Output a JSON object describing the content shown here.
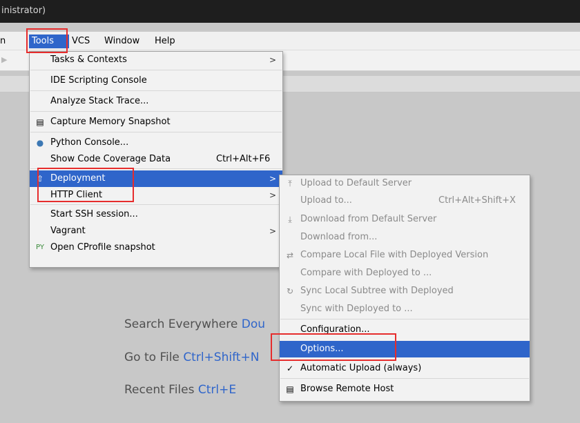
{
  "window": {
    "title": "inistrator)"
  },
  "menubar": {
    "items": [
      {
        "label": "n"
      },
      {
        "label": "Tools"
      },
      {
        "label": "VCS"
      },
      {
        "label": "Window"
      },
      {
        "label": "Help"
      }
    ]
  },
  "tools_menu": {
    "items": [
      {
        "label": "Tasks & Contexts",
        "arrow": ">"
      },
      {
        "label": "IDE Scripting Console"
      },
      {
        "label": "Analyze Stack Trace..."
      },
      {
        "label": "Capture Memory Snapshot",
        "icon": "memory-snapshot-icon"
      },
      {
        "label": "Python Console...",
        "icon": "python-icon"
      },
      {
        "label": "Show Code Coverage Data",
        "shortcut": "Ctrl+Alt+F6"
      },
      {
        "label": "Deployment",
        "arrow": ">",
        "icon": "deployment-icon"
      },
      {
        "label": "HTTP Client",
        "arrow": ">"
      },
      {
        "label": "Start SSH session..."
      },
      {
        "label": "Vagrant",
        "arrow": ">"
      },
      {
        "label": "Open CProfile snapshot",
        "icon": "cprofile-icon"
      }
    ]
  },
  "deployment_menu": {
    "items": [
      {
        "label": "Upload to Default Server",
        "icon": "upload-icon"
      },
      {
        "label": "Upload to...",
        "shortcut": "Ctrl+Alt+Shift+X"
      },
      {
        "label": "Download from Default Server",
        "icon": "download-icon"
      },
      {
        "label": "Download from..."
      },
      {
        "label": "Compare Local File with Deployed Version",
        "icon": "compare-icon"
      },
      {
        "label": "Compare with Deployed to ..."
      },
      {
        "label": "Sync Local Subtree with Deployed",
        "icon": "sync-icon"
      },
      {
        "label": "Sync with Deployed to ..."
      },
      {
        "label": "Configuration..."
      },
      {
        "label": "Options..."
      },
      {
        "label": "Automatic Upload (always)",
        "icon": "checkmark-icon"
      },
      {
        "label": "Browse Remote Host",
        "icon": "remote-host-icon"
      }
    ]
  },
  "editor_hints": {
    "search": {
      "label": "Search Everywhere",
      "shortcut": "Dou"
    },
    "goto": {
      "label": "Go to File",
      "shortcut": "Ctrl+Shift+N"
    },
    "recent": {
      "label": "Recent Files",
      "shortcut": "Ctrl+E"
    }
  },
  "colors": {
    "selection": "#2f65ca",
    "highlight_box": "#e62c2c",
    "title_bar": "#1e1e1e"
  }
}
